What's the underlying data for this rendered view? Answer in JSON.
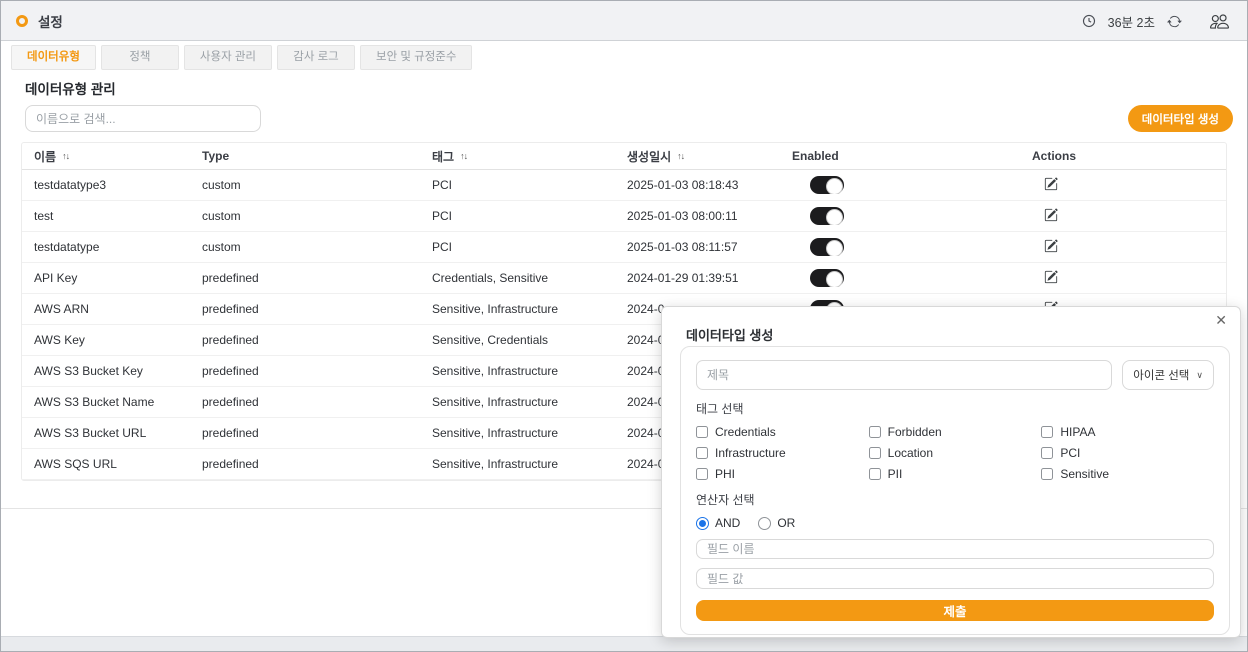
{
  "header": {
    "title": "설정",
    "timer": "36분 2초"
  },
  "tabs": [
    {
      "label": "데이터유형",
      "active": true
    },
    {
      "label": "정책",
      "active": false
    },
    {
      "label": "사용자 관리",
      "active": false
    },
    {
      "label": "감사 로그",
      "active": false
    },
    {
      "label": "보안 및 규정준수",
      "active": false
    }
  ],
  "content": {
    "section_title": "데이터유형 관리",
    "search_placeholder": "이름으로 검색...",
    "create_button_label": "데이터타입 생성"
  },
  "table": {
    "sort_icon": "↑↓",
    "columns": [
      {
        "label": "이름",
        "sortable": true
      },
      {
        "label": "Type",
        "sortable": false
      },
      {
        "label": "태그",
        "sortable": true
      },
      {
        "label": "생성일시",
        "sortable": true
      },
      {
        "label": "Enabled",
        "sortable": false
      },
      {
        "label": "Actions",
        "sortable": false
      }
    ],
    "rows": [
      {
        "name": "testdatatype3",
        "type": "custom",
        "tags": "PCI",
        "created": "2025-01-03 08:18:43",
        "enabled": true
      },
      {
        "name": "test",
        "type": "custom",
        "tags": "PCI",
        "created": "2025-01-03 08:00:11",
        "enabled": true
      },
      {
        "name": "testdatatype",
        "type": "custom",
        "tags": "PCI",
        "created": "2025-01-03 08:11:57",
        "enabled": true
      },
      {
        "name": "API Key",
        "type": "predefined",
        "tags": "Credentials, Sensitive",
        "created": "2024-01-29 01:39:51",
        "enabled": true
      },
      {
        "name": "AWS ARN",
        "type": "predefined",
        "tags": "Sensitive, Infrastructure",
        "created": "2024-0",
        "enabled": true
      },
      {
        "name": "AWS Key",
        "type": "predefined",
        "tags": "Sensitive, Credentials",
        "created": "2024-0",
        "enabled": true
      },
      {
        "name": "AWS S3 Bucket Key",
        "type": "predefined",
        "tags": "Sensitive, Infrastructure",
        "created": "2024-0",
        "enabled": true
      },
      {
        "name": "AWS S3 Bucket Name",
        "type": "predefined",
        "tags": "Sensitive, Infrastructure",
        "created": "2024-0",
        "enabled": true
      },
      {
        "name": "AWS S3 Bucket URL",
        "type": "predefined",
        "tags": "Sensitive, Infrastructure",
        "created": "2024-0",
        "enabled": true
      },
      {
        "name": "AWS SQS URL",
        "type": "predefined",
        "tags": "Sensitive, Infrastructure",
        "created": "2024-0",
        "enabled": true
      }
    ]
  },
  "modal": {
    "title": "데이터타입 생성",
    "close_icon": "✕",
    "name_placeholder": "제목",
    "icon_select_label": "아이콘 선택",
    "chevron_icon": "∨",
    "tags_label": "태그 선택",
    "tag_options": [
      "Credentials",
      "Forbidden",
      "HIPAA",
      "Infrastructure",
      "Location",
      "PCI",
      "PHI",
      "PII",
      "Sensitive"
    ],
    "operator_label": "연산자 선택",
    "operators": [
      {
        "label": "AND",
        "selected": true
      },
      {
        "label": "OR",
        "selected": false
      }
    ],
    "field_name_placeholder": "필드 이름",
    "field_value_placeholder": "필드 값",
    "submit_label": "제출"
  },
  "colors": {
    "accent": "#f39913",
    "toggle_on": "#1c1c1e",
    "radio_selected": "#1a73e8"
  }
}
